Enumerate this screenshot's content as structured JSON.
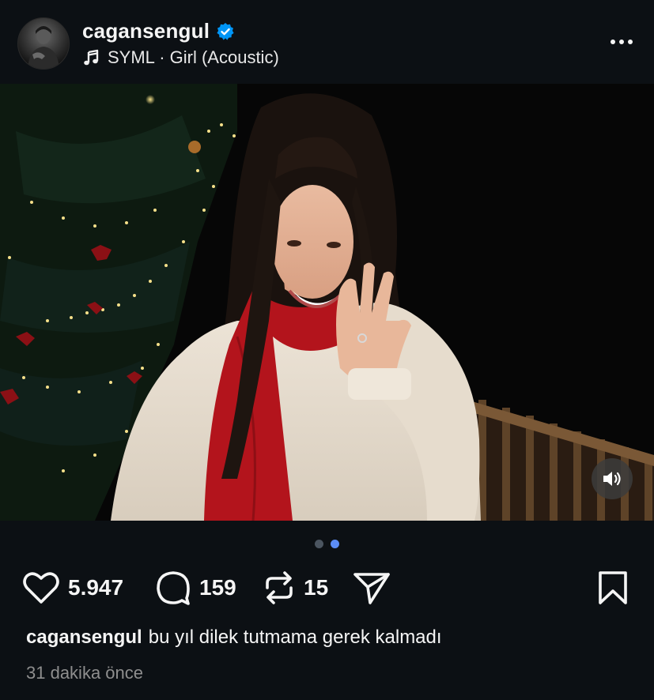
{
  "post": {
    "username": "cagansengul",
    "music": "SYML · Girl (Acoustic)",
    "caption_user": "cagansengul",
    "caption_text": "bu yıl dilek tutmama gerek kalmadı",
    "time_ago": "31 dakika önce",
    "carousel": {
      "count": 2,
      "active_index": 1
    }
  },
  "actions": {
    "likes": "5.947",
    "comments": "159",
    "reposts": "15"
  },
  "colors": {
    "background": "#0c1014",
    "verified": "#0095f6",
    "scarf": "#b3141c",
    "active_dot": "#5b8cf5"
  },
  "icons": [
    "verified-badge-icon",
    "music-note-icon",
    "more-icon",
    "sound-on-icon",
    "heart-icon",
    "comment-icon",
    "repost-icon",
    "share-icon",
    "bookmark-icon"
  ]
}
